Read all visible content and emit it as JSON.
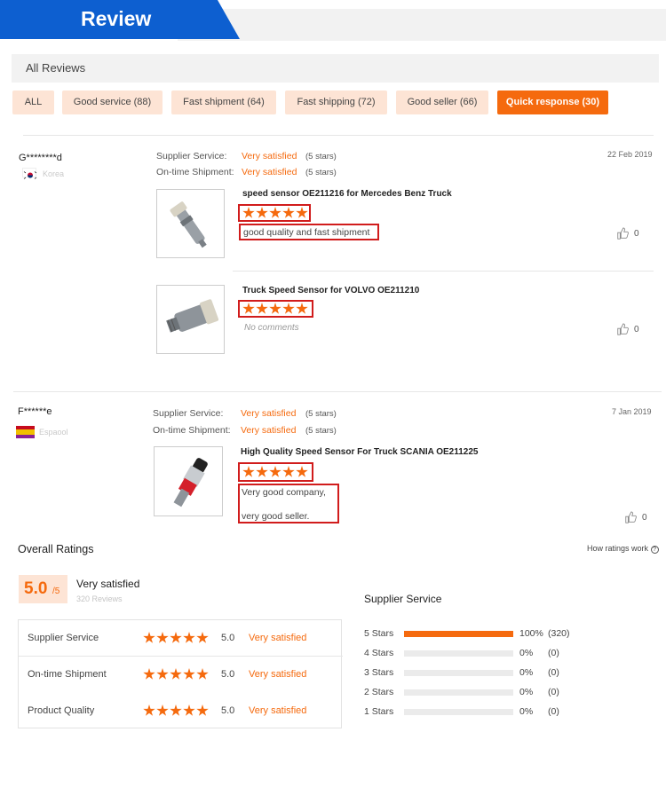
{
  "header": {
    "title": "Review"
  },
  "all_reviews_label": "All Reviews",
  "filters": [
    {
      "label": "ALL"
    },
    {
      "label": "Good service (88)"
    },
    {
      "label": "Fast shipment (64)"
    },
    {
      "label": "Fast shipping (72)"
    },
    {
      "label": "Good seller (66)"
    },
    {
      "label": "Quick response (30)",
      "active": true
    }
  ],
  "reviews": [
    {
      "name": "G********d",
      "country": "Korea",
      "date": "22  Feb 2019",
      "supplier_label": "Supplier Service:",
      "supplier_value": "Very satisfied",
      "supplier_stars": "(5 stars)",
      "shipment_label": "On-time Shipment:",
      "shipment_value": "Very satisfied",
      "shipment_stars": "(5 stars)",
      "items": [
        {
          "title": "speed sensor OE211216 for Mercedes Benz Truck",
          "rating": 5,
          "comment": "good quality and fast shipment",
          "likes": "0"
        },
        {
          "title": "Truck Speed Sensor for VOLVO OE211210",
          "rating": 5,
          "comment": "No comments",
          "likes": "0"
        }
      ]
    },
    {
      "name": "F******e",
      "country": "Espaool",
      "date": "7  Jan 2019",
      "supplier_label": "Supplier Service:",
      "supplier_value": "Very satisfied",
      "supplier_stars": "(5 stars)",
      "shipment_label": "On-time Shipment:",
      "shipment_value": "Very satisfied",
      "shipment_stars": "(5 stars)",
      "items": [
        {
          "title": "High Quality Speed Sensor For Truck SCANIA OE211225",
          "rating": 5,
          "comment_line1": "Very good company,",
          "comment_line2": "very good seller.",
          "likes": "0"
        }
      ]
    }
  ],
  "overall": {
    "title": "Overall Ratings",
    "how_link": "How ratings work",
    "score": "5.0",
    "score_max": "/5",
    "verdict": "Very satisfied",
    "review_count": "320 Reviews",
    "rows": [
      {
        "name": "Supplier Service",
        "score": "5.0",
        "verdict": "Very satisfied",
        "stars": 5
      },
      {
        "name": "On-time Shipment",
        "score": "5.0",
        "verdict": "Very satisfied",
        "stars": 5
      },
      {
        "name": "Product Quality",
        "score": "5.0",
        "verdict": "Very satisfied",
        "stars": 5
      }
    ]
  },
  "supplier_service": {
    "title": "Supplier Service",
    "bars": [
      {
        "label": "5 Stars",
        "percent": "100%",
        "count": "(320)",
        "fraction": 1.0
      },
      {
        "label": "4 Stars",
        "percent": "0%",
        "count": "(0)",
        "fraction": 0
      },
      {
        "label": "3 Stars",
        "percent": "0%",
        "count": "(0)",
        "fraction": 0
      },
      {
        "label": "2 Stars",
        "percent": "0%",
        "count": "(0)",
        "fraction": 0
      },
      {
        "label": "1 Stars",
        "percent": "0%",
        "count": "(0)",
        "fraction": 0
      }
    ]
  },
  "colors": {
    "accent": "#f56a0e",
    "brand_blue": "#0d5fd0",
    "highlight_box": "#d11c1c"
  },
  "icons": {
    "like": "thumbs-up-icon",
    "help": "question-circle-icon"
  }
}
